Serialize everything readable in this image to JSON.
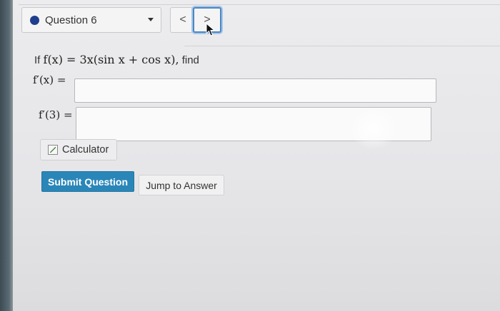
{
  "question_nav": {
    "question_label": "Question 6",
    "status_color": "#1f3f8c",
    "prev_symbol": "<",
    "next_symbol": ">"
  },
  "problem": {
    "prefix": "If",
    "function_text": "f(x) = 3x(sin x + cos x),",
    "suffix": "find"
  },
  "answers": [
    {
      "label": "f′(x) =",
      "value": ""
    },
    {
      "label": "f′(3) =",
      "value": ""
    }
  ],
  "tools": {
    "calculator_label": "Calculator"
  },
  "actions": {
    "submit_label": "Submit Question",
    "submit_color": "#2a86b8",
    "jump_label": "Jump to Answer"
  }
}
